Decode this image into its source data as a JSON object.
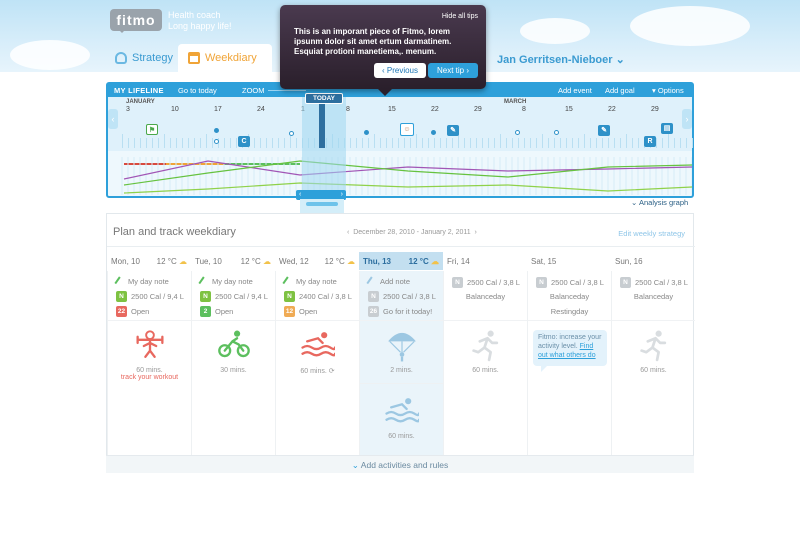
{
  "brand": {
    "logo": "fitmo",
    "tagline_1": "Health coach",
    "tagline_2": "Long happy life!"
  },
  "tabs": [
    {
      "label": "Strategy"
    },
    {
      "label": "Weekdiary"
    }
  ],
  "user": {
    "name": "Jan Gerritsen-Nieboer"
  },
  "tooltip": {
    "hide": "Hide all tips",
    "text": "This is an imporant piece of Fitmo, lorem ipsunm dolor sit amet ertum darmatinem. Esquiat protioni manetiema,. menum.",
    "prev": "Previous",
    "next": "Next tip"
  },
  "lifeline": {
    "title": "MY LIFELINE",
    "goto_today": "Go to today",
    "zoom": "ZOOM",
    "add_event": "Add event",
    "add_goal": "Add goal",
    "options": "Options",
    "today_label": "TODAY",
    "months": [
      "JANUARY",
      "MARCH"
    ],
    "days": [
      "3",
      "10",
      "17",
      "24",
      "1",
      "8",
      "15",
      "22",
      "29",
      "8",
      "15",
      "22",
      "29"
    ],
    "analysis_graph": "Analysis graph"
  },
  "planner": {
    "title": "Plan and track weekdiary",
    "range": "December 28, 2010 - January 2, 2011",
    "edit": "Edit weekly strategy",
    "days": [
      {
        "name": "Mon, 10",
        "temp": "12 °C",
        "note": "My day note",
        "cal": "2500 Cal / 9,4 L",
        "n": "N",
        "num": "22",
        "status": "Open",
        "activity": "60 mins.",
        "extra": "track your workout",
        "icon": "weightlifting-icon"
      },
      {
        "name": "Tue, 10",
        "temp": "12 °C",
        "note": "My day note",
        "cal": "2500 Cal / 9,4 L",
        "n": "N",
        "num": "2",
        "status": "Open",
        "activity": "30 mins.",
        "icon": "cycling-icon"
      },
      {
        "name": "Wed, 12",
        "temp": "12 °C",
        "note": "My day note",
        "cal": "2400 Cal / 3,8 L",
        "n": "N",
        "num": "12",
        "status": "Open",
        "activity": "60 mins.",
        "icon": "swimming-icon"
      },
      {
        "name": "Thu, 13",
        "temp": "12 °C",
        "note": "Add note",
        "cal": "2500 Cal / 3,8 L",
        "n": "N",
        "num": "26",
        "status": "Go for it today!",
        "activity": "2 mins.",
        "activity2": "60 mins.",
        "icon": "parachute-icon"
      },
      {
        "name": "Fri, 14",
        "temp": "",
        "cal": "2500 Cal / 3,8 L",
        "n": "N",
        "line2": "Balanceday",
        "activity": "60 mins.",
        "icon": "running-icon"
      },
      {
        "name": "Sat, 15",
        "temp": "",
        "cal": "2500 Cal / 3,8 L",
        "n": "N",
        "line2": "Balanceday",
        "line3": "Restingday",
        "icon": "running-icon"
      },
      {
        "name": "Sun, 16",
        "temp": "",
        "cal": "2500 Cal / 3,8 L",
        "n": "N",
        "line2": "Balanceday",
        "activity": "60 mins.",
        "icon": "running-icon"
      }
    ],
    "bubble_text": "Fitmo: increase your activity level.",
    "bubble_link": "Find out what others do",
    "add_activities": "Add activities and rules"
  },
  "colors": {
    "accent": "#2ea0da",
    "orange": "#f0a437",
    "red": "#e8685f",
    "green": "#5cbf5e"
  }
}
